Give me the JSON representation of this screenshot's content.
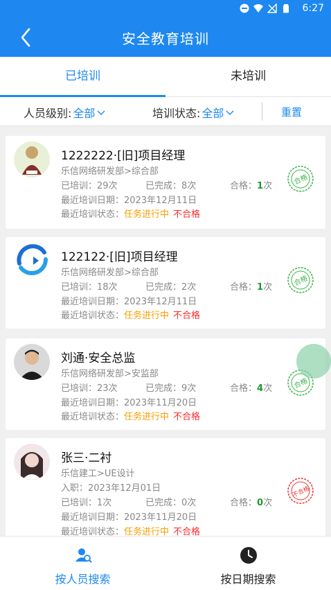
{
  "status_bar": {
    "time": "6:27"
  },
  "app_bar": {
    "title": "安全教育培训"
  },
  "tabs": [
    {
      "label": "已培训"
    },
    {
      "label": "未培训"
    }
  ],
  "filters": {
    "level_label": "人员级别:",
    "level_value": "全部",
    "status_label": "培训状态:",
    "status_value": "全部",
    "reset_label": "重置"
  },
  "people": [
    {
      "name": "1222222·[旧]项目经理",
      "dept": "乐信网络研发部>综合部",
      "trained": "已培训：29次",
      "completed": "已完成：8次",
      "passed_label": "合格：",
      "passed_num": "1",
      "passed_unit": "次",
      "last_date": "最近培训日期：2023年12月11日",
      "last_status_label": "最近培训状态：",
      "task_status": "任务进行中",
      "result": "不合格",
      "stamp": "合格"
    },
    {
      "name": "122122·[旧]项目经理",
      "dept": "乐信网络研发部>综合部",
      "trained": "已培训：18次",
      "completed": "已完成：2次",
      "passed_label": "合格：",
      "passed_num": "1",
      "passed_unit": "次",
      "last_date": "最近培训日期：2023年12月11日",
      "last_status_label": "最近培训状态：",
      "task_status": "任务进行中",
      "result": "不合格",
      "stamp": "合格"
    },
    {
      "name": "刘通·安全总监",
      "dept": "乐信网络研发部>安监部",
      "trained": "已培训：23次",
      "completed": "已完成：9次",
      "passed_label": "合格：",
      "passed_num": "4",
      "passed_unit": "次",
      "last_date": "最近培训日期：2023年11月20日",
      "last_status_label": "最近培训状态：",
      "task_status": "任务进行中",
      "result": "不合格",
      "stamp": "合格"
    },
    {
      "name": "张三·二衬",
      "dept": "乐信建工>UE设计",
      "join_date": "入职：2023年12月01日",
      "trained": "已培训：1次",
      "completed": "已完成：0次",
      "passed_label": "合格：",
      "passed_num": "0",
      "passed_unit": "次",
      "last_date": "最近培训日期：2023年11月20日",
      "last_status_label": "最近培训状态：",
      "task_status": "任务进行中",
      "result": "不合格",
      "stamp": "不合格"
    }
  ],
  "bottom_nav": [
    {
      "label": "按人员搜索"
    },
    {
      "label": "按日期搜索"
    }
  ],
  "colors": {
    "primary": "#1e88f0",
    "pass_green": "#3bb34a",
    "fail_red": "#e53935",
    "orange": "#f5a000"
  },
  "icons": [
    "back-arrow-icon",
    "chevron-down-icon",
    "person-search-icon",
    "clock-icon"
  ]
}
